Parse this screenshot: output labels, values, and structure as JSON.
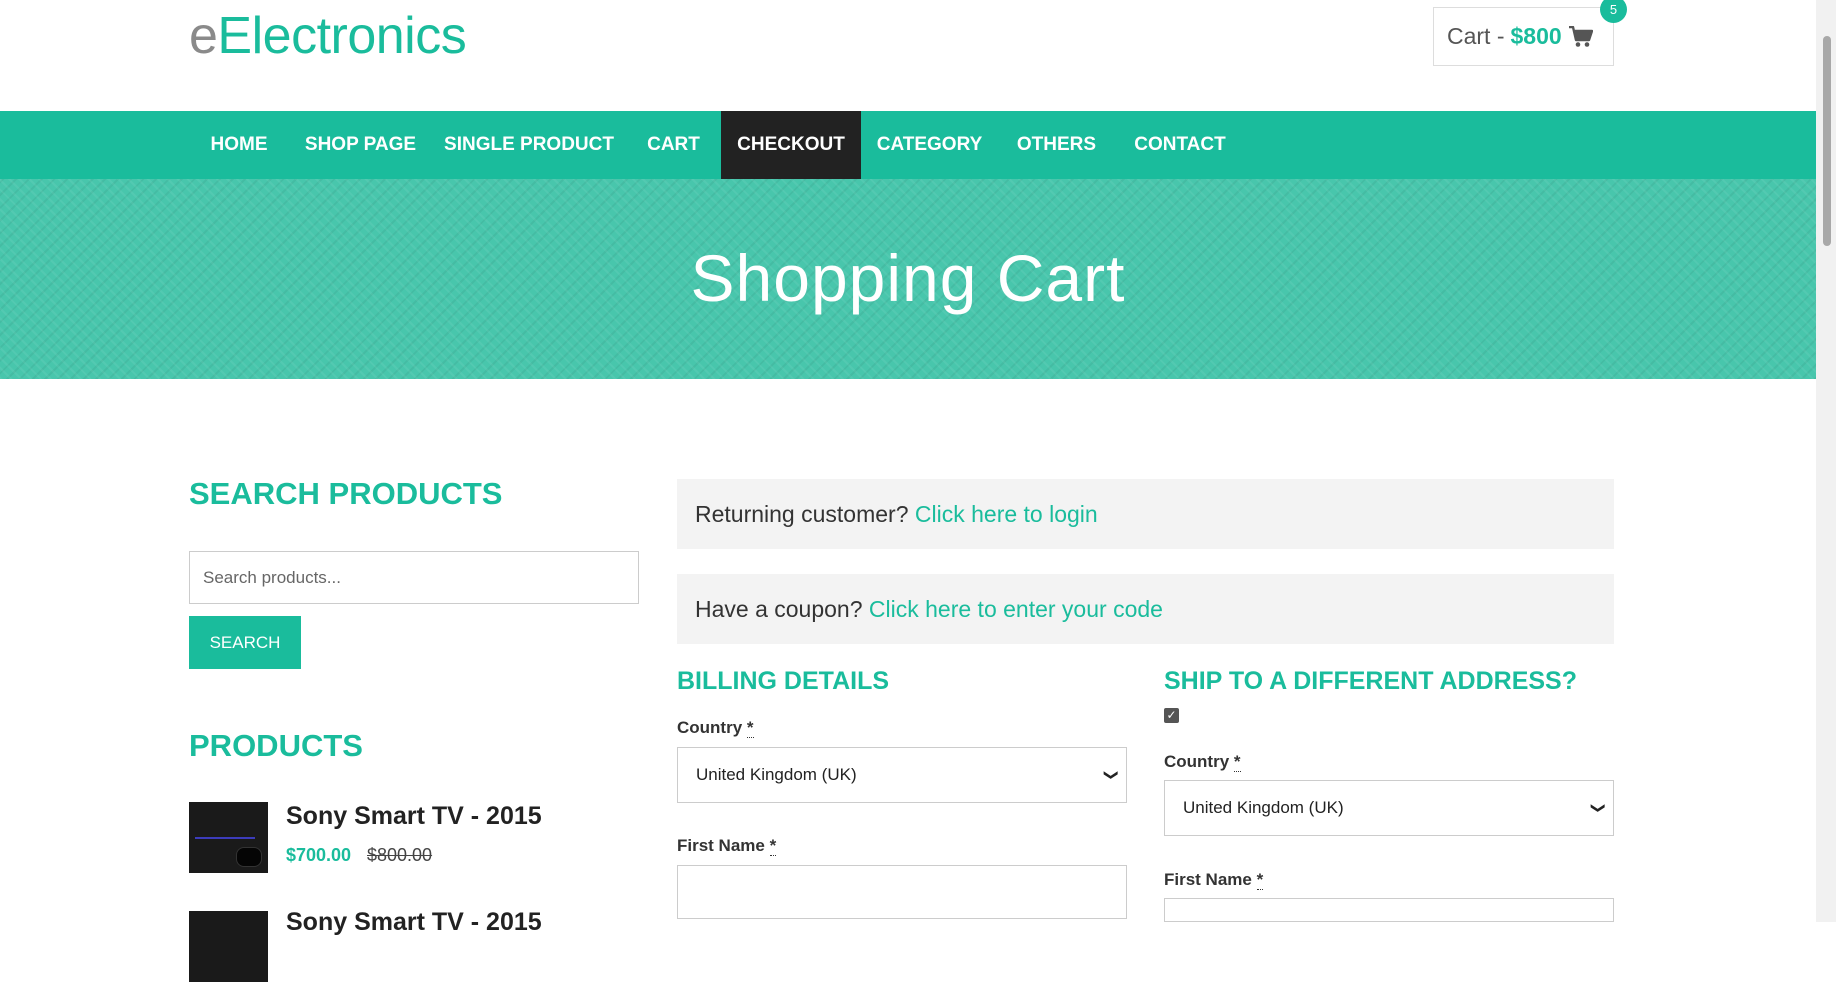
{
  "header": {
    "logo_prefix": "e",
    "logo_main": "Electronics",
    "cart_label": "Cart -",
    "cart_amount": "$800",
    "cart_count": "5"
  },
  "nav": {
    "items": [
      {
        "label": "HOME"
      },
      {
        "label": "SHOP PAGE"
      },
      {
        "label": "SINGLE PRODUCT"
      },
      {
        "label": "CART"
      },
      {
        "label": "CHECKOUT",
        "active": true
      },
      {
        "label": "CATEGORY"
      },
      {
        "label": "OTHERS"
      },
      {
        "label": "CONTACT"
      }
    ]
  },
  "banner": {
    "title": "Shopping Cart"
  },
  "sidebar": {
    "search_title": "SEARCH PRODUCTS",
    "search_placeholder": "Search products...",
    "search_button": "SEARCH",
    "products_title": "PRODUCTS",
    "products": [
      {
        "name": "Sony Smart TV - 2015",
        "price": "$700.00",
        "old_price": "$800.00"
      },
      {
        "name": "Sony Smart TV - 2015"
      }
    ]
  },
  "checkout": {
    "returning_text": "Returning customer?",
    "returning_link": "Click here to login",
    "coupon_text": "Have a coupon?",
    "coupon_link": "Click here to enter your code",
    "billing_title": "BILLING DETAILS",
    "shipping_title": "SHIP TO A DIFFERENT ADDRESS?",
    "ship_checked": true,
    "country_label": "Country",
    "required_mark": "*",
    "country_value": "United Kingdom (UK)",
    "first_name_label": "First Name"
  },
  "colors": {
    "accent": "#1abc9c",
    "nav_active": "#222222"
  },
  "icons": [
    "cart-icon",
    "chevron-down-icon",
    "checkmark-icon"
  ]
}
